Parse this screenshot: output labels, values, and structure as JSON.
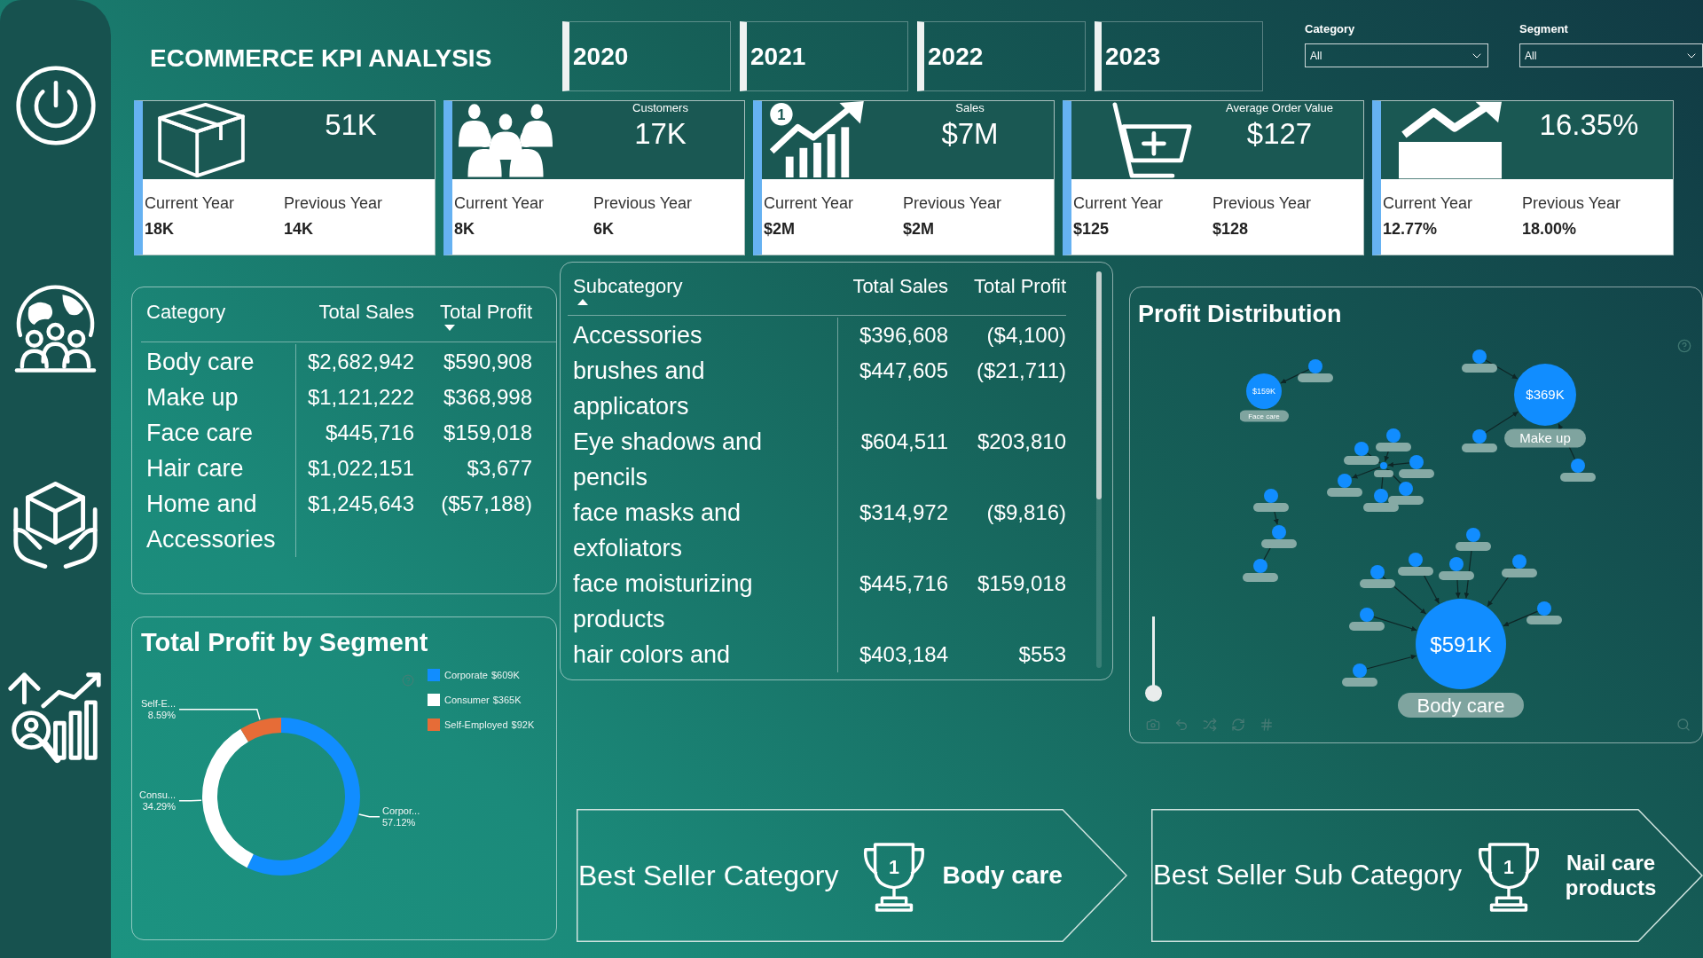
{
  "header": {
    "title": "ECOMMERCE KPI ANALYSIS"
  },
  "year_slicer": [
    {
      "label": "2020",
      "selected": false
    },
    {
      "label": "2021",
      "selected": false
    },
    {
      "label": "2022",
      "selected": false
    },
    {
      "label": "2023",
      "selected": false
    }
  ],
  "filters": [
    {
      "label": "Category",
      "value": "All"
    },
    {
      "label": "Segment",
      "value": "All"
    }
  ],
  "kpi_cards": [
    {
      "value": "51K",
      "current_label": "Current Year",
      "current_value": "18K",
      "previous_label": "Previous Year",
      "previous_value": "14K"
    },
    {
      "title": "Customers",
      "value": "17K",
      "current_label": "Current Year",
      "current_value": "8K",
      "previous_label": "Previous Year",
      "previous_value": "6K"
    },
    {
      "title": "Sales",
      "value": "$7M",
      "icon_text": "1",
      "current_label": "Current Year",
      "current_value": "$2M",
      "previous_label": "Previous Year",
      "previous_value": "$2M"
    },
    {
      "title": "Average Order Value",
      "value": "$127",
      "current_label": "Current Year",
      "current_value": "$125",
      "previous_label": "Previous Year",
      "previous_value": "$128"
    },
    {
      "value": "16.35%",
      "current_label": "Current Year",
      "current_value": "12.77%",
      "previous_label": "Previous Year",
      "previous_value": "18.00%"
    }
  ],
  "category_table": {
    "columns": [
      {
        "label": "Category"
      },
      {
        "label": "Total Sales"
      },
      {
        "label": "Total Profit",
        "sorted": true,
        "descending": true
      }
    ],
    "rows": [
      [
        "Body care",
        "$2,682,942",
        "$590,908"
      ],
      [
        "Make up",
        "$1,121,222",
        "$368,998"
      ],
      [
        "Face care",
        "$445,716",
        "$159,018"
      ],
      [
        "Hair care",
        "$1,022,151",
        "$3,677"
      ],
      [
        "Home and Accessories",
        "$1,245,643",
        "($57,188)"
      ]
    ]
  },
  "subcategory_table": {
    "columns": [
      {
        "label": "Subcategory",
        "sorted": true,
        "descending": false
      },
      {
        "label": "Total Sales"
      },
      {
        "label": "Total Profit"
      }
    ],
    "rows": [
      [
        "Accessories",
        "$396,608",
        "($4,100)"
      ],
      [
        "brushes and applicators",
        "$447,605",
        "($21,711)"
      ],
      [
        "Eye shadows and pencils",
        "$604,511",
        "$203,810"
      ],
      [
        "face masks and exfoliators",
        "$314,972",
        "($9,816)"
      ],
      [
        "face moisturizing products",
        "$445,716",
        "$159,018"
      ],
      [
        "hair colors and",
        "$403,184",
        "$553"
      ]
    ]
  },
  "segment_chart": {
    "chart_data": {
      "type": "donut",
      "title": "Total Profit by Segment",
      "categories": [
        "Corporate",
        "Consumer",
        "Self-Employed"
      ],
      "values": [
        57.12,
        34.29,
        8.59
      ],
      "colors": [
        "#118dff",
        "#ffffff",
        "#e66c37"
      ]
    },
    "legend_values": [
      "$609K",
      "$365K",
      "$92K"
    ],
    "slice_labels": [
      {
        "name": "Self-E...",
        "percent": "8.59%"
      },
      {
        "name": "Consu...",
        "percent": "34.29%"
      },
      {
        "name": "Corpor...",
        "percent": "57.12%"
      }
    ]
  },
  "profit_distribution": {
    "title": "Profit Distribution",
    "nodes": [
      {
        "value": "$159K",
        "label": "Face care"
      },
      {
        "value": "$369K",
        "label": "Make up"
      },
      {
        "value": "$591K",
        "label": "Body care"
      }
    ],
    "slider": {
      "level": 0
    }
  },
  "best_sellers": [
    {
      "label": "Best Seller Category",
      "rank": "1",
      "value": "Body care"
    },
    {
      "label": "Best Seller Sub Category",
      "rank": "1",
      "value": "Nail care products"
    }
  ]
}
